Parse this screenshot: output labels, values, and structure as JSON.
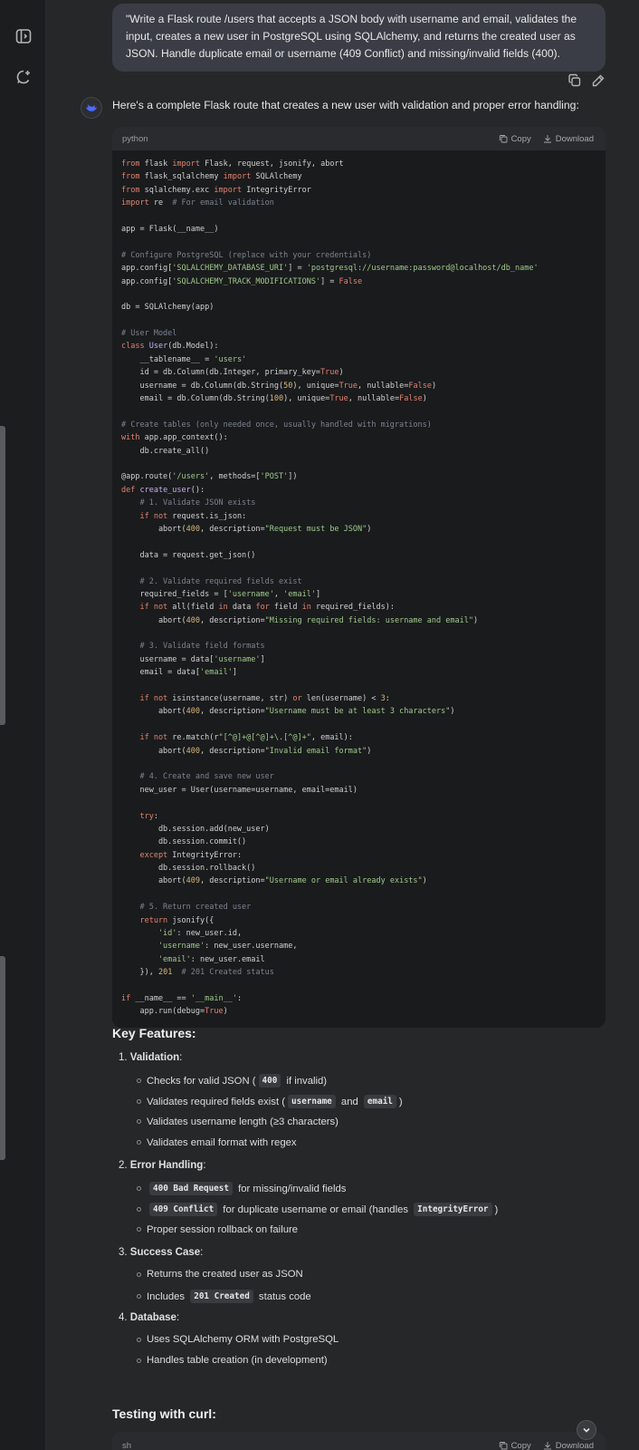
{
  "user_message": "\"Write a Flask route /users that accepts a JSON body with username and email, validates the input, creates a new user in PostgreSQL using SQLAlchemy, and returns the created user as JSON. Handle duplicate email or username (409 Conflict) and missing/invalid fields (400).",
  "assistant_intro": "Here's a complete Flask route that creates a new user with validation and proper error handling:",
  "code_block": {
    "language": "python",
    "copy_label": "Copy",
    "download_label": "Download",
    "lines": [
      [
        [
          "kw",
          "from"
        ],
        [
          "plain",
          " flask "
        ],
        [
          "kw",
          "import"
        ],
        [
          "plain",
          " Flask, request, jsonify, abort"
        ]
      ],
      [
        [
          "kw",
          "from"
        ],
        [
          "plain",
          " flask_sqlalchemy "
        ],
        [
          "kw",
          "import"
        ],
        [
          "plain",
          " SQLAlchemy"
        ]
      ],
      [
        [
          "kw",
          "from"
        ],
        [
          "plain",
          " sqlalchemy.exc "
        ],
        [
          "kw",
          "import"
        ],
        [
          "plain",
          " IntegrityError"
        ]
      ],
      [
        [
          "kw",
          "import"
        ],
        [
          "plain",
          " re  "
        ],
        [
          "com",
          "# For email validation"
        ]
      ],
      [],
      [
        [
          "plain",
          "app = Flask(__name__)"
        ]
      ],
      [],
      [
        [
          "com",
          "# Configure PostgreSQL (replace with your credentials)"
        ]
      ],
      [
        [
          "plain",
          "app.config["
        ],
        [
          "str",
          "'SQLALCHEMY_DATABASE_URI'"
        ],
        [
          "plain",
          "] = "
        ],
        [
          "str",
          "'postgresql://username:password@localhost/db_name'"
        ]
      ],
      [
        [
          "plain",
          "app.config["
        ],
        [
          "str",
          "'SQLALCHEMY_TRACK_MODIFICATIONS'"
        ],
        [
          "plain",
          "] = "
        ],
        [
          "kw",
          "False"
        ]
      ],
      [],
      [
        [
          "plain",
          "db = SQLAlchemy(app)"
        ]
      ],
      [],
      [
        [
          "com",
          "# User Model"
        ]
      ],
      [
        [
          "kw",
          "class"
        ],
        [
          "fn",
          " User"
        ],
        [
          "plain",
          "(db.Model):"
        ]
      ],
      [
        [
          "plain",
          "    __tablename__ = "
        ],
        [
          "str",
          "'users'"
        ]
      ],
      [
        [
          "plain",
          "    id = db.Column(db.Integer, primary_key="
        ],
        [
          "kw",
          "True"
        ],
        [
          "plain",
          ")"
        ]
      ],
      [
        [
          "plain",
          "    username = db.Column(db.String("
        ],
        [
          "num",
          "50"
        ],
        [
          "plain",
          "), unique="
        ],
        [
          "kw",
          "True"
        ],
        [
          "plain",
          ", nullable="
        ],
        [
          "kw",
          "False"
        ],
        [
          "plain",
          ")"
        ]
      ],
      [
        [
          "plain",
          "    email = db.Column(db.String("
        ],
        [
          "num",
          "100"
        ],
        [
          "plain",
          "), unique="
        ],
        [
          "kw",
          "True"
        ],
        [
          "plain",
          ", nullable="
        ],
        [
          "kw",
          "False"
        ],
        [
          "plain",
          ")"
        ]
      ],
      [],
      [
        [
          "com",
          "# Create tables (only needed once, usually handled with migrations)"
        ]
      ],
      [
        [
          "kw",
          "with"
        ],
        [
          "plain",
          " app.app_context():"
        ]
      ],
      [
        [
          "plain",
          "    db.create_all()"
        ]
      ],
      [],
      [
        [
          "plain",
          "@app.route("
        ],
        [
          "str",
          "'/users'"
        ],
        [
          "plain",
          ", methods=["
        ],
        [
          "str",
          "'POST'"
        ],
        [
          "plain",
          "])"
        ]
      ],
      [
        [
          "kw",
          "def"
        ],
        [
          "fn",
          " create_user"
        ],
        [
          "plain",
          "():"
        ]
      ],
      [
        [
          "com",
          "    # 1. Validate JSON exists"
        ]
      ],
      [
        [
          "kw",
          "    if not"
        ],
        [
          "plain",
          " request.is_json:"
        ]
      ],
      [
        [
          "plain",
          "        abort("
        ],
        [
          "num",
          "400"
        ],
        [
          "plain",
          ", description="
        ],
        [
          "str",
          "\"Request must be JSON\""
        ],
        [
          "plain",
          ")"
        ]
      ],
      [],
      [
        [
          "plain",
          "    data = request.get_json()"
        ]
      ],
      [],
      [
        [
          "com",
          "    # 2. Validate required fields exist"
        ]
      ],
      [
        [
          "plain",
          "    required_fields = ["
        ],
        [
          "str",
          "'username'"
        ],
        [
          "plain",
          ", "
        ],
        [
          "str",
          "'email'"
        ],
        [
          "plain",
          "]"
        ]
      ],
      [
        [
          "kw",
          "    if not"
        ],
        [
          "plain",
          " all(field "
        ],
        [
          "kw",
          "in"
        ],
        [
          "plain",
          " data "
        ],
        [
          "kw",
          "for"
        ],
        [
          "plain",
          " field "
        ],
        [
          "kw",
          "in"
        ],
        [
          "plain",
          " required_fields):"
        ]
      ],
      [
        [
          "plain",
          "        abort("
        ],
        [
          "num",
          "400"
        ],
        [
          "plain",
          ", description="
        ],
        [
          "str",
          "\"Missing required fields: username and email\""
        ],
        [
          "plain",
          ")"
        ]
      ],
      [],
      [
        [
          "com",
          "    # 3. Validate field formats"
        ]
      ],
      [
        [
          "plain",
          "    username = data["
        ],
        [
          "str",
          "'username'"
        ],
        [
          "plain",
          "]"
        ]
      ],
      [
        [
          "plain",
          "    email = data["
        ],
        [
          "str",
          "'email'"
        ],
        [
          "plain",
          "]"
        ]
      ],
      [],
      [
        [
          "kw",
          "    if not"
        ],
        [
          "plain",
          " isinstance(username, str) "
        ],
        [
          "kw",
          "or"
        ],
        [
          "plain",
          " len(username) < "
        ],
        [
          "num",
          "3"
        ],
        [
          "plain",
          ":"
        ]
      ],
      [
        [
          "plain",
          "        abort("
        ],
        [
          "num",
          "400"
        ],
        [
          "plain",
          ", description="
        ],
        [
          "str",
          "\"Username must be at least 3 characters\""
        ],
        [
          "plain",
          ")"
        ]
      ],
      [],
      [
        [
          "kw",
          "    if not"
        ],
        [
          "plain",
          " re.match(r"
        ],
        [
          "str",
          "\"[^@]+@[^@]+\\.[^@]+\""
        ],
        [
          "plain",
          ", email):"
        ]
      ],
      [
        [
          "plain",
          "        abort("
        ],
        [
          "num",
          "400"
        ],
        [
          "plain",
          ", description="
        ],
        [
          "str",
          "\"Invalid email format\""
        ],
        [
          "plain",
          ")"
        ]
      ],
      [],
      [
        [
          "com",
          "    # 4. Create and save new user"
        ]
      ],
      [
        [
          "plain",
          "    new_user = User(username=username, email=email)"
        ]
      ],
      [],
      [
        [
          "kw",
          "    try"
        ],
        [
          "plain",
          ":"
        ]
      ],
      [
        [
          "plain",
          "        db.session.add(new_user)"
        ]
      ],
      [
        [
          "plain",
          "        db.session.commit()"
        ]
      ],
      [
        [
          "kw",
          "    except"
        ],
        [
          "plain",
          " IntegrityError:"
        ]
      ],
      [
        [
          "plain",
          "        db.session.rollback()"
        ]
      ],
      [
        [
          "plain",
          "        abort("
        ],
        [
          "num",
          "409"
        ],
        [
          "plain",
          ", description="
        ],
        [
          "str",
          "\"Username or email already exists\""
        ],
        [
          "plain",
          ")"
        ]
      ],
      [],
      [
        [
          "com",
          "    # 5. Return created user"
        ]
      ],
      [
        [
          "kw",
          "    return"
        ],
        [
          "plain",
          " jsonify({"
        ]
      ],
      [
        [
          "str",
          "        'id'"
        ],
        [
          "plain",
          ": new_user.id,"
        ]
      ],
      [
        [
          "str",
          "        'username'"
        ],
        [
          "plain",
          ": new_user.username,"
        ]
      ],
      [
        [
          "str",
          "        'email'"
        ],
        [
          "plain",
          ": new_user.email"
        ]
      ],
      [
        [
          "plain",
          "    }), "
        ],
        [
          "num",
          "201"
        ],
        [
          "com",
          "  # 201 Created status"
        ]
      ],
      [],
      [
        [
          "kw",
          "if"
        ],
        [
          "plain",
          " __name__ == "
        ],
        [
          "str",
          "'__main__'"
        ],
        [
          "plain",
          ":"
        ]
      ],
      [
        [
          "plain",
          "    app.run(debug="
        ],
        [
          "kw",
          "True"
        ],
        [
          "plain",
          ")"
        ]
      ]
    ]
  },
  "key_features": {
    "title": "Key Features:",
    "items": [
      {
        "num": "1.",
        "label": "Validation",
        "suffix": ":",
        "bullets": [
          [
            [
              "t",
              "Checks for valid JSON ("
            ],
            [
              "c",
              "400"
            ],
            [
              "t",
              " if invalid)"
            ]
          ],
          [
            [
              "t",
              "Validates required fields exist ("
            ],
            [
              "c",
              "username"
            ],
            [
              "t",
              " and "
            ],
            [
              "c",
              "email"
            ],
            [
              "t",
              ")"
            ]
          ],
          [
            [
              "t",
              "Validates username length (≥3 characters)"
            ]
          ],
          [
            [
              "t",
              "Validates email format with regex"
            ]
          ]
        ]
      },
      {
        "num": "2.",
        "label": "Error Handling",
        "suffix": ":",
        "bullets": [
          [
            [
              "c",
              "400 Bad Request"
            ],
            [
              "t",
              " for missing/invalid fields"
            ]
          ],
          [
            [
              "c",
              "409 Conflict"
            ],
            [
              "t",
              " for duplicate username or email (handles "
            ],
            [
              "c",
              "IntegrityError"
            ],
            [
              "t",
              ")"
            ]
          ],
          [
            [
              "t",
              "Proper session rollback on failure"
            ]
          ]
        ]
      },
      {
        "num": "3.",
        "label": "Success Case",
        "suffix": ":",
        "bullets": [
          [
            [
              "t",
              "Returns the created user as JSON"
            ]
          ],
          [
            [
              "t",
              "Includes "
            ],
            [
              "c",
              "201 Created"
            ],
            [
              "t",
              " status code"
            ]
          ]
        ]
      },
      {
        "num": "4.",
        "label": "Database",
        "suffix": ":",
        "bullets": [
          [
            [
              "t",
              "Uses SQLAlchemy ORM with PostgreSQL"
            ]
          ],
          [
            [
              "t",
              "Handles table creation (in development)"
            ]
          ]
        ]
      }
    ]
  },
  "testing": {
    "title": "Testing with curl:",
    "code_language": "sh",
    "copy_label": "Copy",
    "download_label": "Download"
  }
}
